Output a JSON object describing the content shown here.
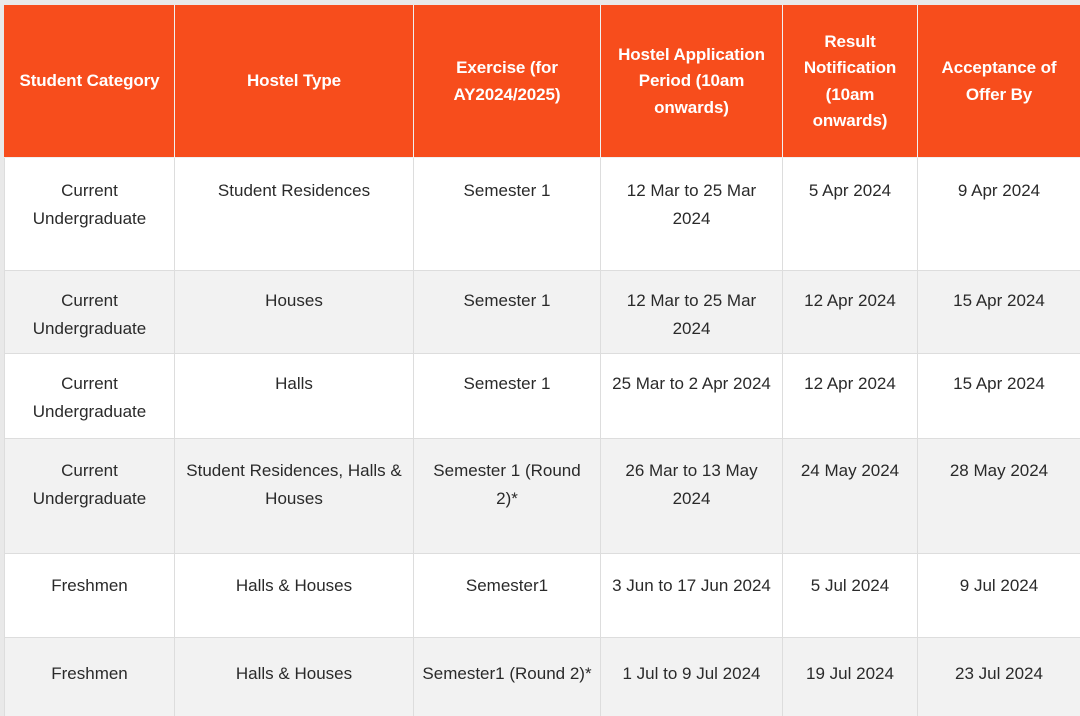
{
  "table": {
    "accent_color": "#f74d1c",
    "header_text_color": "#ffffff",
    "alt_row_color": "#f2f2f2",
    "row_color": "#ffffff",
    "border_color": "#dddddd",
    "columns": [
      "Student Category",
      "Hostel Type",
      "Exercise (for AY2024/2025)",
      "Hostel Application Period (10am onwards)",
      "Result Notification (10am onwards)",
      "Acceptance of Offer By"
    ],
    "rows": [
      {
        "student_category": "Current Undergraduate",
        "hostel_type": "Student Residences",
        "exercise": "Semester 1",
        "application_period": "12 Mar to 25 Mar 2024",
        "result_notification": "5 Apr 2024",
        "acceptance_by": "9 Apr 2024"
      },
      {
        "student_category": "Current Undergraduate",
        "hostel_type": "Houses",
        "exercise": "Semester 1",
        "application_period": "12 Mar to 25 Mar 2024",
        "result_notification": "12 Apr 2024",
        "acceptance_by": "15 Apr 2024"
      },
      {
        "student_category": "Current Undergraduate",
        "hostel_type": "Halls",
        "exercise": "Semester 1",
        "application_period": "25 Mar to 2 Apr 2024",
        "result_notification": "12 Apr 2024",
        "acceptance_by": "15 Apr 2024"
      },
      {
        "student_category": "Current Undergraduate",
        "hostel_type": "Student Residences, Halls & Houses",
        "exercise": "Semester 1 (Round 2)*",
        "application_period": "26 Mar to 13 May 2024",
        "result_notification": "24 May 2024",
        "acceptance_by": "28 May 2024"
      },
      {
        "student_category": "Freshmen",
        "hostel_type": "Halls & Houses",
        "exercise": "Semester1",
        "application_period": "3 Jun to 17 Jun 2024",
        "result_notification": "5 Jul 2024",
        "acceptance_by": "9 Jul 2024"
      },
      {
        "student_category": "Freshmen",
        "hostel_type": "Halls & Houses",
        "exercise": "Semester1 (Round 2)*",
        "application_period": "1 Jul to 9 Jul 2024",
        "result_notification": "19 Jul 2024",
        "acceptance_by": "23 Jul 2024"
      }
    ]
  }
}
